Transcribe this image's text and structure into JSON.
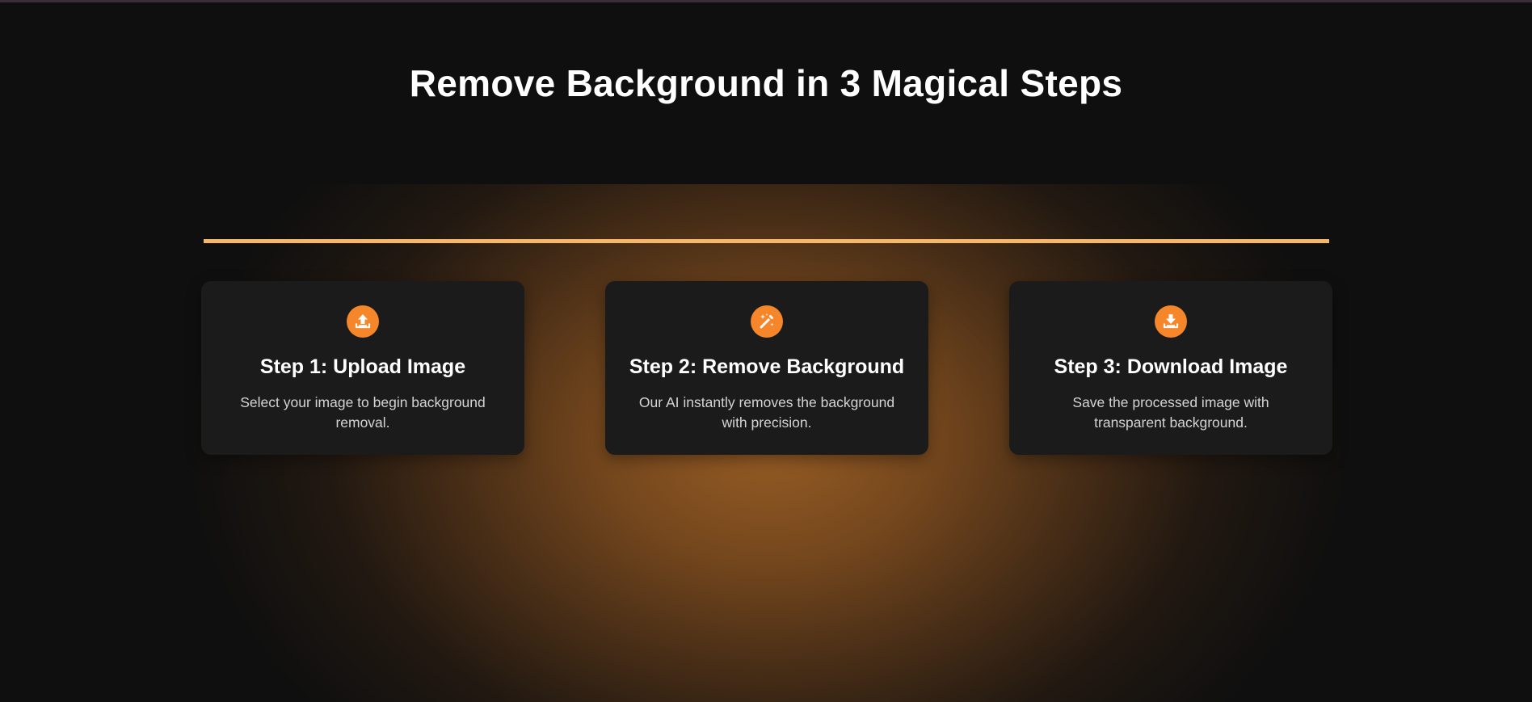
{
  "page": {
    "title": "Remove Background in 3 Magical Steps"
  },
  "colors": {
    "background": "#0f0f0f",
    "accent": "#f5872a",
    "divider": "#f6b76b",
    "card": "#1b1b1b",
    "glow": "#965c24"
  },
  "steps": [
    {
      "icon": "upload-icon",
      "title": "Step 1: Upload Image",
      "description": "Select your image to begin background removal."
    },
    {
      "icon": "magic-wand-icon",
      "title": "Step 2: Remove Background",
      "description": "Our AI instantly removes the background with precision."
    },
    {
      "icon": "download-icon",
      "title": "Step 3: Download Image",
      "description": "Save the processed image with transparent background."
    }
  ]
}
